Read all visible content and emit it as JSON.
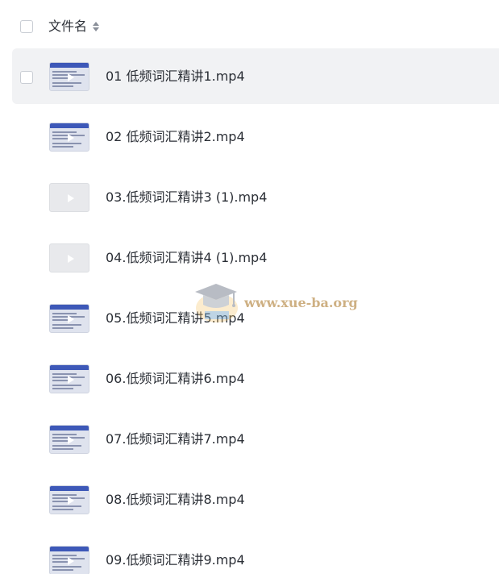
{
  "header": {
    "column_label": "文件名"
  },
  "files": [
    {
      "name": "01 低频词汇精讲1.mp4",
      "thumbnail": "video-frame",
      "hovered": true
    },
    {
      "name": "02 低频词汇精讲2.mp4",
      "thumbnail": "video-frame",
      "hovered": false
    },
    {
      "name": "03.低频词汇精讲3 (1).mp4",
      "thumbnail": "blank",
      "hovered": false
    },
    {
      "name": "04.低频词汇精讲4 (1).mp4",
      "thumbnail": "blank",
      "hovered": false
    },
    {
      "name": "05.低频词汇精讲5.mp4",
      "thumbnail": "video-frame",
      "hovered": false
    },
    {
      "name": "06.低频词汇精讲6.mp4",
      "thumbnail": "video-frame",
      "hovered": false
    },
    {
      "name": "07.低频词汇精讲7.mp4",
      "thumbnail": "video-frame",
      "hovered": false
    },
    {
      "name": "08.低频词汇精讲8.mp4",
      "thumbnail": "video-frame",
      "hovered": false
    },
    {
      "name": "09.低频词汇精讲9.mp4",
      "thumbnail": "video-frame",
      "hovered": false
    }
  ],
  "watermark": {
    "text": "www.xue-ba.org"
  },
  "colors": {
    "hover_row": "#f1f2f4",
    "thumb_header": "#3d58b8",
    "watermark": "#be965a"
  }
}
